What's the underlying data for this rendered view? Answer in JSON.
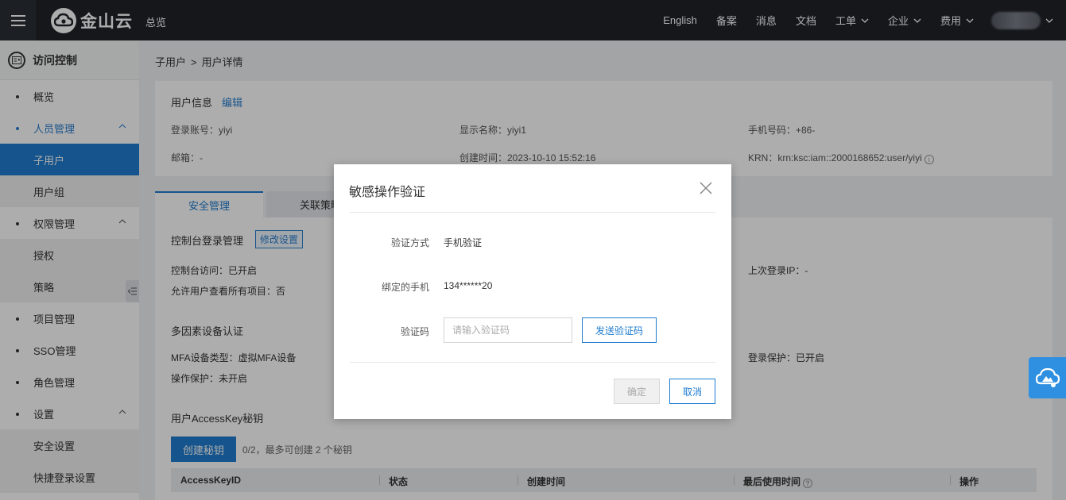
{
  "topbar": {
    "logo_text": "金山云",
    "overview": "总览",
    "nav": [
      {
        "label": "English",
        "has_dropdown": false
      },
      {
        "label": "备案",
        "has_dropdown": false
      },
      {
        "label": "消息",
        "has_dropdown": false
      },
      {
        "label": "文档",
        "has_dropdown": false
      },
      {
        "label": "工单",
        "has_dropdown": true
      },
      {
        "label": "企业",
        "has_dropdown": true
      },
      {
        "label": "费用",
        "has_dropdown": true
      }
    ]
  },
  "sidebar": {
    "title": "访问控制",
    "items": {
      "overview": "概览",
      "people": "人员管理",
      "sub_user": "子用户",
      "user_group": "用户组",
      "permission": "权限管理",
      "authorize": "授权",
      "policy": "策略",
      "project": "项目管理",
      "sso": "SSO管理",
      "role": "角色管理",
      "settings": "设置",
      "security_settings": "安全设置",
      "quick_login": "快捷登录设置"
    }
  },
  "breadcrumb": {
    "parent": "子用户",
    "separator": ">",
    "current": "用户详情"
  },
  "user_info": {
    "heading": "用户信息",
    "edit": "编辑",
    "login_account": "登录账号：yiyi",
    "display_name": "显示名称：yiyi1",
    "phone": "手机号码：+86-",
    "email": "邮箱：-",
    "created": "创建时间：2023-10-10 15:52:16",
    "krn": "KRN：krn:ksc:iam::2000168652:user/yiyi"
  },
  "tabs": [
    "安全管理",
    "关联策略"
  ],
  "security": {
    "console_login_title": "控制台登录管理",
    "modify_settings": "修改设置",
    "console_access": "控制台访问：已开启",
    "view_all_projects": "允许用户查看所有项目：否",
    "last_login_ip": "上次登录IP：-",
    "mfa_title": "多因素设备认证",
    "mfa_type": "MFA设备类型：虚拟MFA设备",
    "login_protect": "登录保护：已开启",
    "operation_protect": "操作保护：未开启",
    "accesskey_title": "用户AccessKey秘钥",
    "create_key": "创建秘钥",
    "key_quota": "0/2，最多可创建 2 个秘钥",
    "table_headers": [
      "AccessKeyID",
      "状态",
      "创建时间",
      "最后使用时间",
      "操作"
    ]
  },
  "modal": {
    "title": "敏感操作验证",
    "method_label": "验证方式",
    "method_value": "手机验证",
    "phone_label": "绑定的手机",
    "phone_value": "134******20",
    "code_label": "验证码",
    "code_placeholder": "请输入验证码",
    "code_value": "",
    "send_code": "发送验证码",
    "confirm": "确定",
    "cancel": "取消"
  },
  "colors": {
    "accent": "#1f7ccf",
    "topbar": "#1f2329",
    "help_float": "#2f8fe0"
  }
}
